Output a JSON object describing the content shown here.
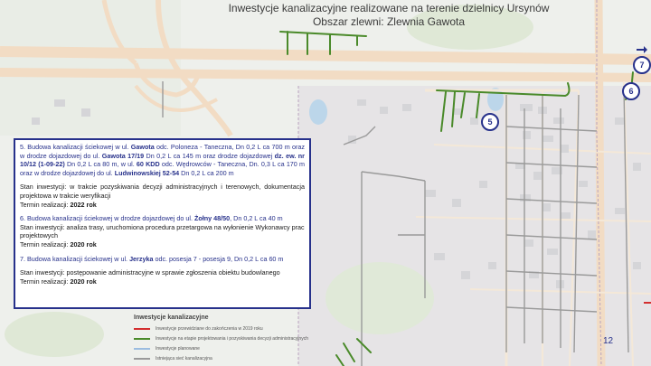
{
  "title": {
    "line1": "Inwestycje kanalizacyjne realizowane na terenie dzielnicy Ursynów",
    "line2": "Obszar zlewni: Zlewnia Gawota"
  },
  "markers": [
    "5",
    "6",
    "7"
  ],
  "info": {
    "item5": {
      "p1": "5. Budowa kanalizacji ściekowej w ul. ",
      "street": "Gawota",
      "p2": " odc. Poloneza - Taneczna, Dn 0,2 L ca 700 m oraz w drodze dojazdowej do ul. ",
      "addr1": "Gawota 17/19",
      "p3": " Dn 0,2 L ca 145 m oraz drodze dojazdowej ",
      "addr2": "dz. ew. nr 10/12 (1-09-22)",
      "p4": " Dn 0,2 L ca 80 m, w ul. ",
      "addr3": "60 KDD",
      "p5": " odc. Wędrowców - Taneczna, Dn. 0,3 L ca 170 m oraz w drodze dojazdowej do ul. ",
      "addr4": "Ludwinowskiej 52-54",
      "p6": " Dn 0,2 L ca 200 m",
      "status": "Stan inwestycji: w trakcie pozyskiwania decyzji administracyjnych i terenowych, dokumentacja projektowa w trakcie weryfikacji",
      "term_label": "Termin realizacji: ",
      "term_value": "2022 rok"
    },
    "item6": {
      "p1": "6. Budowa kanalizacji ściekowej w drodze dojazdowej do ul. ",
      "addr": "Żołny 48/50",
      "p2": ", Dn 0,2 L ca 40 m",
      "status": "Stan inwestycji: analiza trasy, uruchomiona procedura przetargowa na wyłonienie Wykonawcy prac projektowych",
      "term_label": "Termin realizacji: ",
      "term_value": "2020 rok"
    },
    "item7": {
      "p1": "7. Budowa kanalizacji ściekowej w ul. ",
      "street": "Jerzyka",
      "p2": " odc. posesja 7 - posesja 9, Dn 0,2 L ca 60 m",
      "status": "Stan inwestycji: postępowanie administracyjne w sprawie zgłoszenia obiektu budowlanego",
      "term_label": "Termin realizacji: ",
      "term_value": "2020 rok"
    }
  },
  "legend": {
    "title": "Inwestycje kanalizacyjne",
    "items": [
      {
        "label": "Inwestycje przewidziane do zakończenia w 2019 roku",
        "color": "#d32f2f"
      },
      {
        "label": "Inwestycje na etapie projektowania i pozyskiwania decyzji administracyjnych",
        "color": "#4a8a2a"
      },
      {
        "label": "Inwestycje planowane",
        "color": "#9bbce0"
      },
      {
        "label": "Istniejąca sieć kanalizacyjna",
        "color": "#9a9a9a"
      }
    ]
  },
  "page_number": "12",
  "colors": {
    "accent": "#27318b",
    "planned_sewer": "#4a8a2a",
    "existing_sewer": "#9a9a9a",
    "map_bg": "#eef0ec",
    "road": "#f2dcc4"
  }
}
